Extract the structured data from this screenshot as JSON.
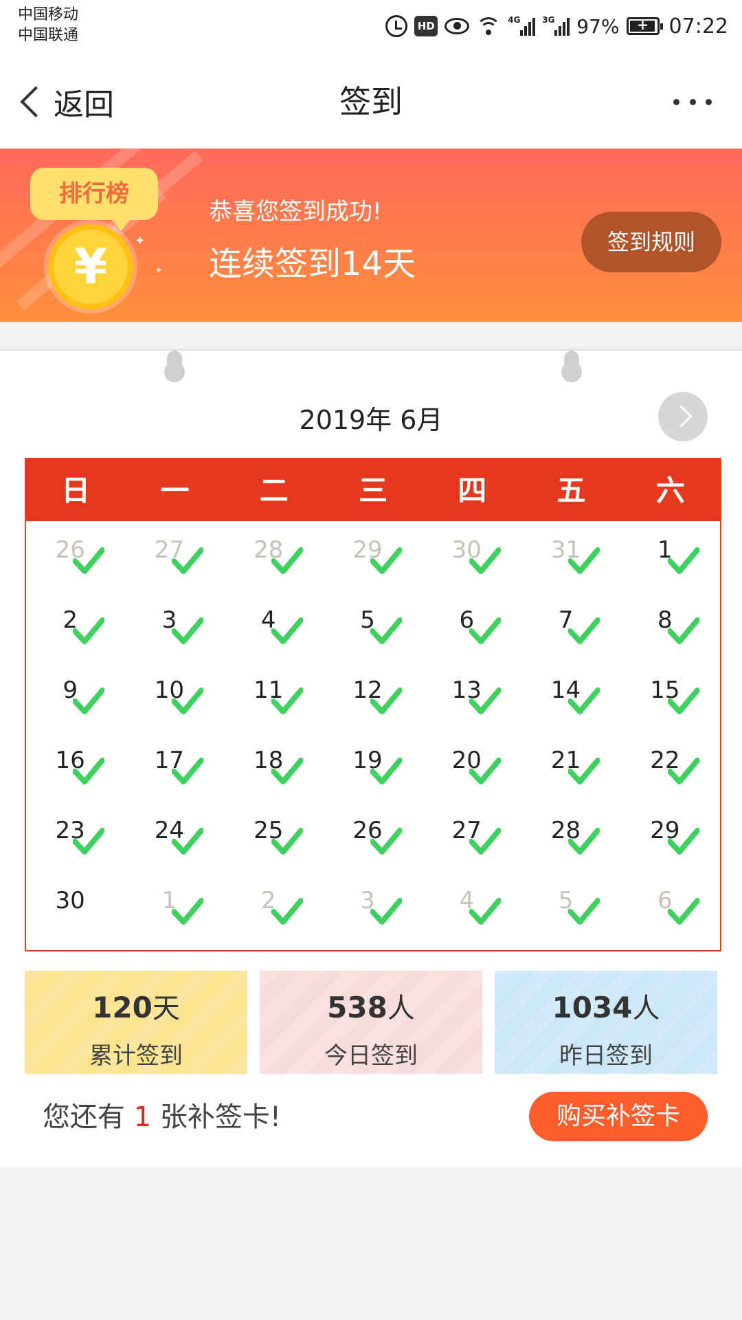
{
  "status_bar": {
    "carrier1": "中国移动",
    "carrier2": "中国联通",
    "hd": "HD",
    "signal1_label": "4G",
    "signal2_label": "3G",
    "battery": "97%",
    "battery_level": 0.97,
    "time": "07:22",
    "icons": [
      "alarm-icon",
      "hd-icon",
      "eye-icon",
      "wifi-icon",
      "signal-icon",
      "battery-icon"
    ]
  },
  "nav": {
    "back_label": "返回",
    "title": "签到",
    "more_icon": "more-icon"
  },
  "banner": {
    "rank_label": "排行榜",
    "coin_symbol": "¥",
    "congrats": "恭喜您签到成功!",
    "streak": "连续签到14天",
    "rules_button": "签到规则"
  },
  "calendar": {
    "month_label": "2019年 6月",
    "weekdays": [
      "日",
      "一",
      "二",
      "三",
      "四",
      "五",
      "六"
    ],
    "days": [
      {
        "d": "26",
        "other": true,
        "checked": true
      },
      {
        "d": "27",
        "other": true,
        "checked": true
      },
      {
        "d": "28",
        "other": true,
        "checked": true
      },
      {
        "d": "29",
        "other": true,
        "checked": true
      },
      {
        "d": "30",
        "other": true,
        "checked": true
      },
      {
        "d": "31",
        "other": true,
        "checked": true
      },
      {
        "d": "1",
        "other": false,
        "checked": true
      },
      {
        "d": "2",
        "other": false,
        "checked": true
      },
      {
        "d": "3",
        "other": false,
        "checked": true
      },
      {
        "d": "4",
        "other": false,
        "checked": true
      },
      {
        "d": "5",
        "other": false,
        "checked": true
      },
      {
        "d": "6",
        "other": false,
        "checked": true
      },
      {
        "d": "7",
        "other": false,
        "checked": true
      },
      {
        "d": "8",
        "other": false,
        "checked": true
      },
      {
        "d": "9",
        "other": false,
        "checked": true
      },
      {
        "d": "10",
        "other": false,
        "checked": true
      },
      {
        "d": "11",
        "other": false,
        "checked": true
      },
      {
        "d": "12",
        "other": false,
        "checked": true
      },
      {
        "d": "13",
        "other": false,
        "checked": true
      },
      {
        "d": "14",
        "other": false,
        "checked": true
      },
      {
        "d": "15",
        "other": false,
        "checked": true
      },
      {
        "d": "16",
        "other": false,
        "checked": true
      },
      {
        "d": "17",
        "other": false,
        "checked": true
      },
      {
        "d": "18",
        "other": false,
        "checked": true
      },
      {
        "d": "19",
        "other": false,
        "checked": true
      },
      {
        "d": "20",
        "other": false,
        "checked": true
      },
      {
        "d": "21",
        "other": false,
        "checked": true
      },
      {
        "d": "22",
        "other": false,
        "checked": true
      },
      {
        "d": "23",
        "other": false,
        "checked": true
      },
      {
        "d": "24",
        "other": false,
        "checked": true
      },
      {
        "d": "25",
        "other": false,
        "checked": true
      },
      {
        "d": "26",
        "other": false,
        "checked": true
      },
      {
        "d": "27",
        "other": false,
        "checked": true
      },
      {
        "d": "28",
        "other": false,
        "checked": true
      },
      {
        "d": "29",
        "other": false,
        "checked": true
      },
      {
        "d": "30",
        "other": false,
        "checked": false
      },
      {
        "d": "1",
        "other": true,
        "checked": true
      },
      {
        "d": "2",
        "other": true,
        "checked": true
      },
      {
        "d": "3",
        "other": true,
        "checked": true
      },
      {
        "d": "4",
        "other": true,
        "checked": true
      },
      {
        "d": "5",
        "other": true,
        "checked": true
      },
      {
        "d": "6",
        "other": true,
        "checked": true
      }
    ]
  },
  "stats": [
    {
      "value": "120",
      "unit": "天",
      "label": "累计签到"
    },
    {
      "value": "538",
      "unit": "人",
      "label": "今日签到"
    },
    {
      "value": "1034",
      "unit": "人",
      "label": "昨日签到"
    }
  ],
  "makeup": {
    "prefix": "您还有 ",
    "count": "1",
    "suffix": " 张补签卡!",
    "buy_button": "购买补签卡"
  },
  "colors": {
    "calendar_red": "#e4391f",
    "check_green": "#3fd160",
    "banner_top": "#ff6a5a",
    "banner_bottom": "#ff8f3c",
    "buy_button": "#ff5e2b"
  }
}
